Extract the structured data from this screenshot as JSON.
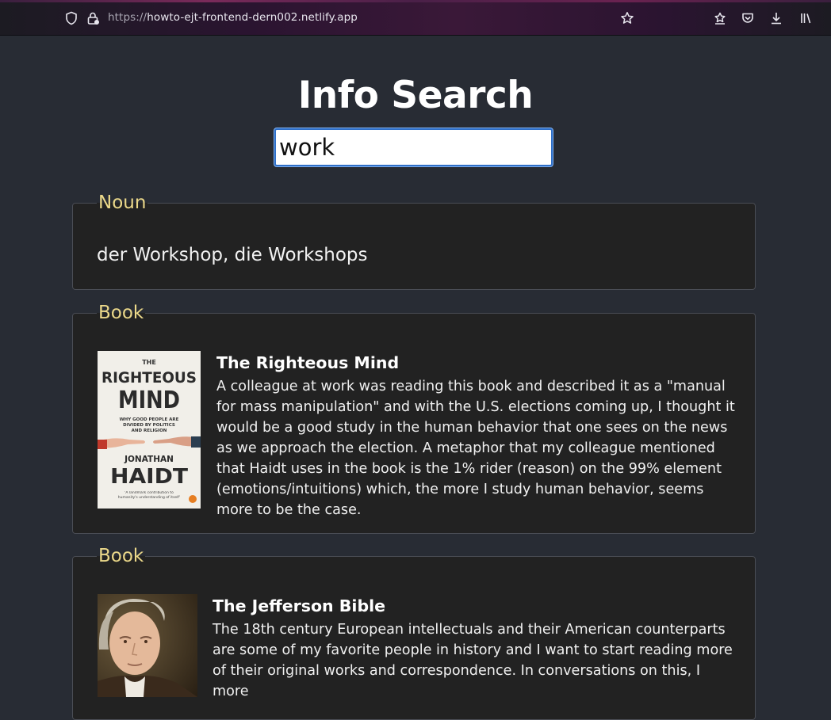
{
  "browser": {
    "url_proto": "https://",
    "url_host": "howto-ejt-frontend-dern002.netlify.app",
    "icons": [
      "shield-icon",
      "lock-icon",
      "star-icon",
      "bookmark-star-icon",
      "pocket-icon",
      "download-icon",
      "library-icon"
    ]
  },
  "header": {
    "title": "Info Search"
  },
  "search": {
    "value": "work",
    "placeholder": ""
  },
  "results": {
    "noun": {
      "legend": "Noun",
      "text": "der Workshop, die Workshops"
    },
    "books": [
      {
        "legend": "Book",
        "title": "The Righteous Mind",
        "description": "A colleague at work was reading this book and described it as a \"manual for mass manipulation\" and with the U.S. elections coming up, I thought it would be a good study in the human behavior that one sees on the news as we approach the election. A metaphor that my colleague mentioned that Haidt uses in the book is the 1% rider (reason) on the 99% element (emotions/intuitions) which, the more I study human behavior, seems more to be the case.",
        "cover": {
          "line1": "THE",
          "line2": "RIGHTEOUS",
          "line3": "MIND",
          "subtitle": "WHY GOOD PEOPLE ARE DIVIDED BY POLITICS AND RELIGION",
          "author1": "JONATHAN",
          "author2": "HAIDT",
          "quote": "'A landmark contribution to humanity's understanding of itself'"
        }
      },
      {
        "legend": "Book",
        "title": "The Jefferson Bible",
        "description": "The 18th century European intellectuals and their American counterparts are some of my favorite people in history and I want to start reading more of their original works and correspondence. In conversations on this, I more"
      }
    ]
  },
  "colors": {
    "background": "#282c34",
    "card": "#222222",
    "legend": "#ecd98a",
    "input_border": "#2f6fc7"
  }
}
